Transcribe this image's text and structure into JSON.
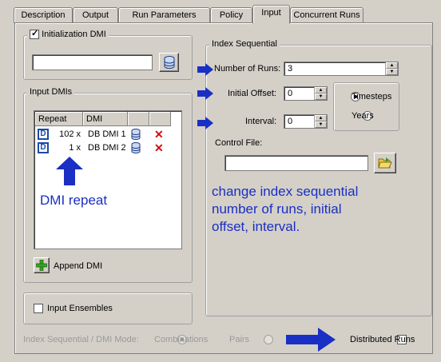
{
  "tabs": [
    {
      "label": "Description"
    },
    {
      "label": "Output"
    },
    {
      "label": "Run Parameters"
    },
    {
      "label": "Policy"
    },
    {
      "label": "Input"
    },
    {
      "label": "Concurrent Runs"
    }
  ],
  "active_tab": "Input",
  "init_dmi": {
    "label": "Initialization DMI",
    "checked": true,
    "value": ""
  },
  "input_dmis": {
    "label": "Input DMIs",
    "columns": [
      "Repeat",
      "DMI",
      "",
      ""
    ],
    "rows": [
      {
        "icon": "D",
        "repeat": "102 x",
        "dmi": "DB DMI 1"
      },
      {
        "icon": "D",
        "repeat": "1 x",
        "dmi": "DB DMI 2"
      }
    ],
    "append_label": "Append DMI"
  },
  "input_ensembles": {
    "label": "Input Ensembles",
    "checked": false
  },
  "index_sequential": {
    "label": "Index Sequential",
    "num_runs_label": "Number of Runs:",
    "num_runs": "3",
    "initial_offset_label": "Initial Offset:",
    "initial_offset": "0",
    "interval_label": "Interval:",
    "interval": "0",
    "units": [
      "Timesteps",
      "Years"
    ],
    "selected_unit": "Timesteps",
    "control_file_label": "Control File:",
    "control_file": ""
  },
  "mode": {
    "label": "Index Sequential / DMI Mode:",
    "options": [
      "Combinations",
      "Pairs"
    ],
    "selected": "Combinations"
  },
  "distributed_runs": {
    "label": "Distributed Runs",
    "checked": false
  },
  "annotations": {
    "dmi_repeat": "DMI repeat",
    "index_seq_note": [
      "change index sequential",
      "number of runs, initial",
      "offset, interval."
    ]
  },
  "colors": {
    "annotation": "#1a2fc4",
    "background": "#d4d0c8"
  }
}
